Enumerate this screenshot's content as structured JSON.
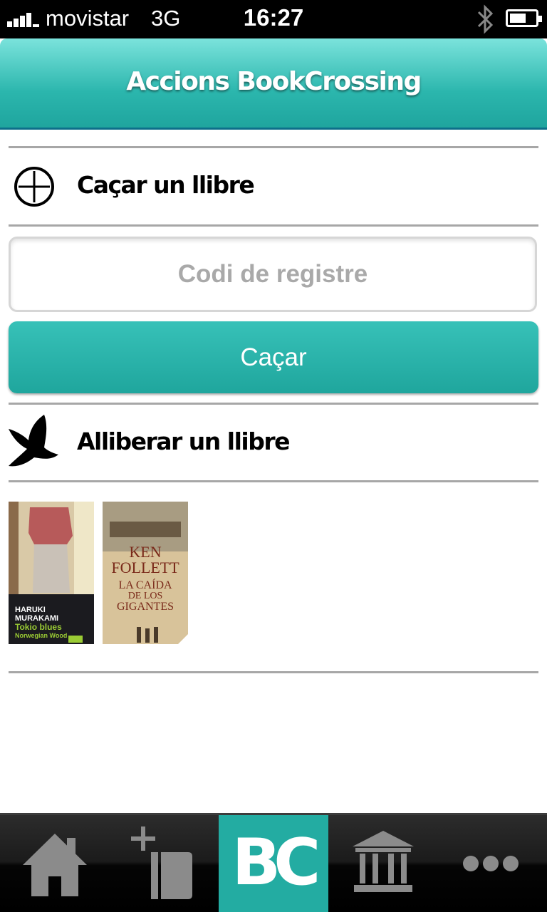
{
  "status_bar": {
    "carrier": "movistar",
    "network": "3G",
    "time": "16:27",
    "icons": [
      "signal-icon",
      "bluetooth-icon",
      "battery-icon"
    ]
  },
  "header": {
    "title": "Accions BookCrossing"
  },
  "hunt_section": {
    "label": "Caçar un llibre",
    "icon": "add-circle-icon",
    "input_placeholder": "Codi de registre",
    "input_value": "",
    "button_label": "Caçar"
  },
  "release_section": {
    "label": "Alliberar un llibre",
    "icon": "dove-icon"
  },
  "books": [
    {
      "author_line1": "HARUKI",
      "author_line2": "MURAKAMI",
      "title_line1": "Tokio blues",
      "title_line2": "Norwegian Wood"
    },
    {
      "author_line1": "KEN",
      "author_line2": "FOLLETT",
      "title_line1": "LA CAÍDA",
      "title_line2": "DE LOS",
      "title_line3": "GIGANTES"
    }
  ],
  "tab_bar": {
    "tabs": [
      {
        "icon": "home-icon",
        "active": false
      },
      {
        "icon": "add-book-icon",
        "active": false
      },
      {
        "icon": "bc-logo-icon",
        "label": "BC",
        "active": true
      },
      {
        "icon": "library-icon",
        "active": false
      },
      {
        "icon": "more-icon",
        "active": false
      }
    ]
  },
  "colors": {
    "accent": "#23aca2",
    "header_top": "#7be3dc",
    "header_bottom": "#1fa59e",
    "divider": "#a7a7a7"
  }
}
